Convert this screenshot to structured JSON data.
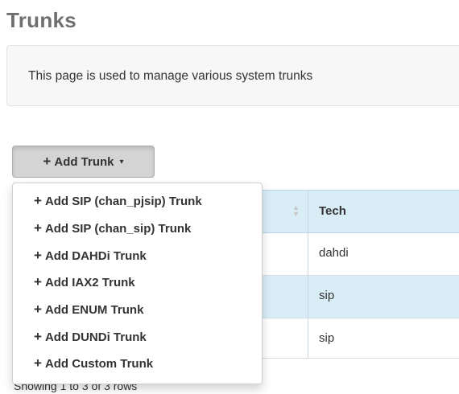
{
  "page": {
    "title": "Trunks",
    "description": "This page is used to manage various system trunks"
  },
  "toolbar": {
    "add_trunk_label": "Add Trunk",
    "plus_glyph": "+",
    "caret_glyph": "▾"
  },
  "dropdown": {
    "items": [
      {
        "label": "Add SIP (chan_pjsip) Trunk",
        "icon": "plus-icon"
      },
      {
        "label": "Add SIP (chan_sip) Trunk",
        "icon": "plus-icon"
      },
      {
        "label": "Add DAHDi Trunk",
        "icon": "plus-icon"
      },
      {
        "label": "Add IAX2 Trunk",
        "icon": "plus-icon"
      },
      {
        "label": "Add ENUM Trunk",
        "icon": "plus-icon"
      },
      {
        "label": "Add DUNDi Trunk",
        "icon": "plus-icon"
      },
      {
        "label": "Add Custom Trunk",
        "icon": "plus-icon"
      }
    ]
  },
  "table": {
    "columns": {
      "tech": "Tech"
    },
    "rows": [
      {
        "tech": "dahdi"
      },
      {
        "tech": "sip"
      },
      {
        "tech": "sip"
      }
    ],
    "footer": "Showing 1 to 3 of 3 rows"
  },
  "colors": {
    "header_bg": "#d9edf7",
    "striped_row_bg": "#d9edf7",
    "button_active_bg": "#d4d4d4",
    "title_color": "#6f6f6f"
  }
}
